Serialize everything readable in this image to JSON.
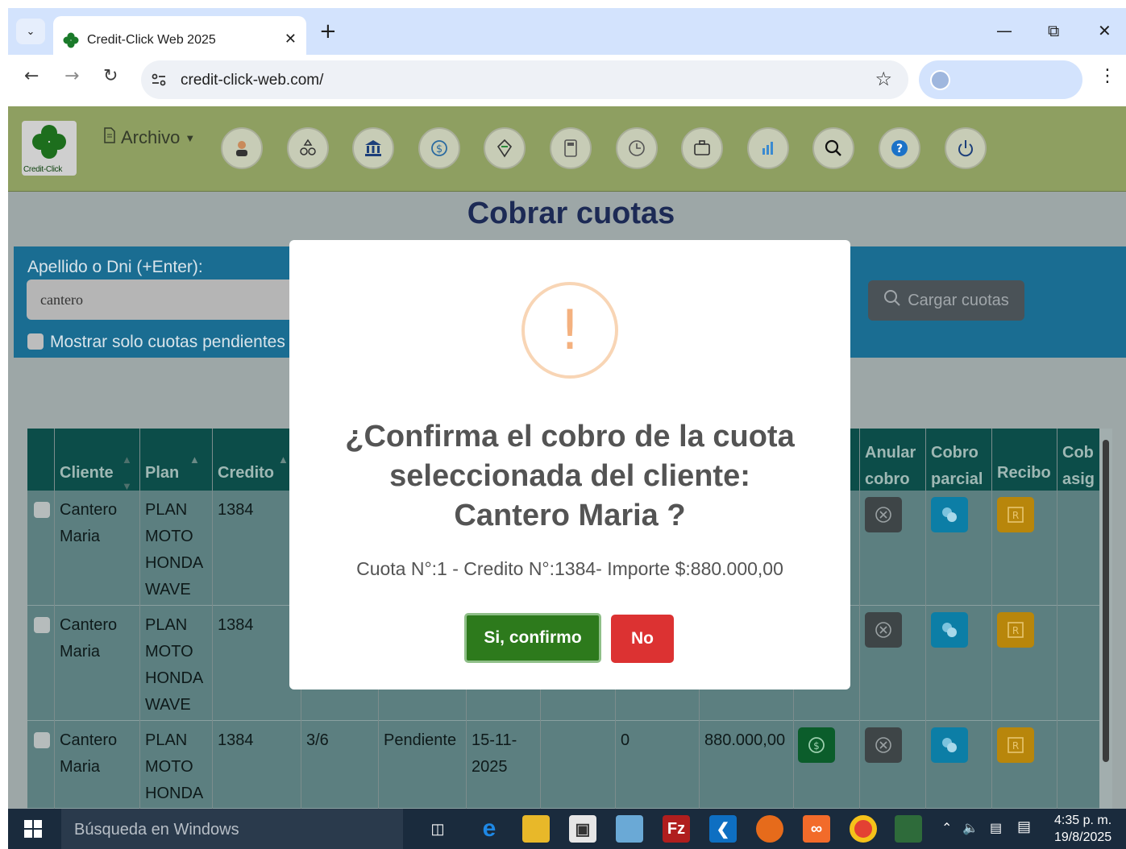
{
  "browser": {
    "tab_title": "Credit-Click Web 2025",
    "url": "credit-click-web.com/"
  },
  "app": {
    "logo_text": "Credit-Click",
    "archivo_label": "Archivo",
    "nav_icons": [
      "person-icon",
      "shapes-icon",
      "bank-icon",
      "money-icon",
      "gem-icon",
      "calculator-icon",
      "clock-icon",
      "briefcase-icon",
      "bar-chart-icon",
      "search-icon",
      "help-icon",
      "power-icon"
    ]
  },
  "page": {
    "heading": "Cobrar cuotas",
    "search_label": "Apellido o Dni (+Enter):",
    "search_value": "cantero",
    "pending_label": "Mostrar solo cuotas pendientes",
    "load_button": "Cargar cuotas"
  },
  "table": {
    "headers": {
      "cliente": "Cliente",
      "plan": "Plan",
      "credito": "Credito",
      "anular_1": "Anular",
      "anular_2": "cobro",
      "cobro_1": "Cobro",
      "cobro_2": "parcial",
      "recibo": "Recibo",
      "cob_1": "Cob",
      "cob_2": "asig"
    },
    "rows": [
      {
        "cliente_1": "Cantero",
        "cliente_2": "Maria",
        "plan_1": "PLAN",
        "plan_2": "MOTO",
        "plan_3": "HONDA",
        "plan_4": "WAVE",
        "credito": "1384"
      },
      {
        "cliente_1": "Cantero",
        "cliente_2": "Maria",
        "plan_1": "PLAN",
        "plan_2": "MOTO",
        "plan_3": "HONDA",
        "plan_4": "WAVE",
        "credito": "1384"
      },
      {
        "cliente_1": "Cantero",
        "cliente_2": "Maria",
        "plan_1": "PLAN",
        "plan_2": "MOTO",
        "plan_3": "HONDA",
        "credito": "1384",
        "cuota": "3/6",
        "estado": "Pendiente",
        "vto_1": "15-11-",
        "vto_2": "2025",
        "pagado": "0",
        "importe": "880.000,00"
      }
    ]
  },
  "modal": {
    "title_1": "¿Confirma el cobro de la cuota",
    "title_2": "seleccionada del cliente:",
    "title_3": "Cantero Maria ?",
    "text": "Cuota N°:1 - Credito N°:1384- Importe $:880.000,00",
    "confirm": "Si, confirmo",
    "cancel": "No"
  },
  "taskbar": {
    "search_placeholder": "Búsqueda en Windows",
    "time": "4:35 p. m.",
    "date": "19/8/2025"
  }
}
